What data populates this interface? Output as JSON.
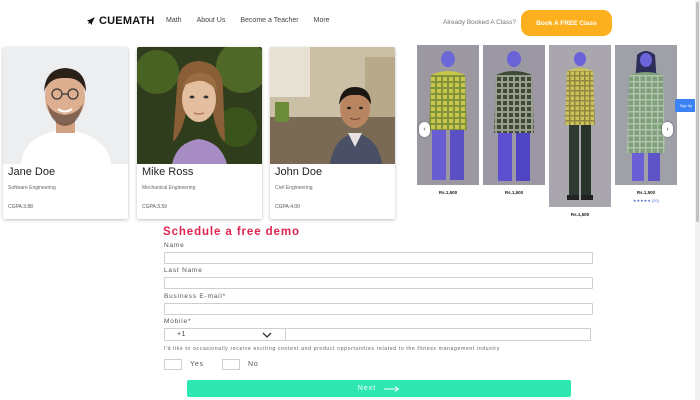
{
  "nav": {
    "brand": "CUEMATH",
    "links": [
      "Math",
      "About Us",
      "Become a Teacher",
      "More"
    ],
    "booked_text": "Already Booked A Class?",
    "cta_label": "Book A FREE Class",
    "accent": "#fdb01d"
  },
  "profiles": [
    {
      "name": "Jane Doe",
      "department": "Software Engineering",
      "gpa": "CGPA:3.88"
    },
    {
      "name": "Mike Ross",
      "department": "Mechanical Engineering",
      "gpa": "CGPA:3.59"
    },
    {
      "name": "John Doe",
      "department": "Civil Engineering",
      "gpa": "CGPA:4.00"
    }
  ],
  "products": [
    {
      "price": "Rs.1,500",
      "rating": ""
    },
    {
      "price": "Rs.1,500",
      "rating": ""
    },
    {
      "price": "Rs.1,500",
      "rating": ""
    },
    {
      "price": "Rs.1,500",
      "rating": "★★★★★ (20)"
    }
  ],
  "carousel": {
    "prev_icon": "chevron-left-icon",
    "next_icon": "chevron-right-icon"
  },
  "side_tag": "Sign Up",
  "form": {
    "title": "Schedule a free demo",
    "title_color": "#e0244d",
    "name_label": "Name",
    "last_name_label": "Last Name",
    "email_label": "Business E-mail*",
    "mobile_label": "Mobile*",
    "country_code": "+1",
    "consent_text": "I'd like to occasionally receive exciting content and product opportunities related to the fitness management industry",
    "yes_label": "Yes",
    "no_label": "No",
    "next_label": "Next",
    "next_color": "#2fe7b1"
  }
}
